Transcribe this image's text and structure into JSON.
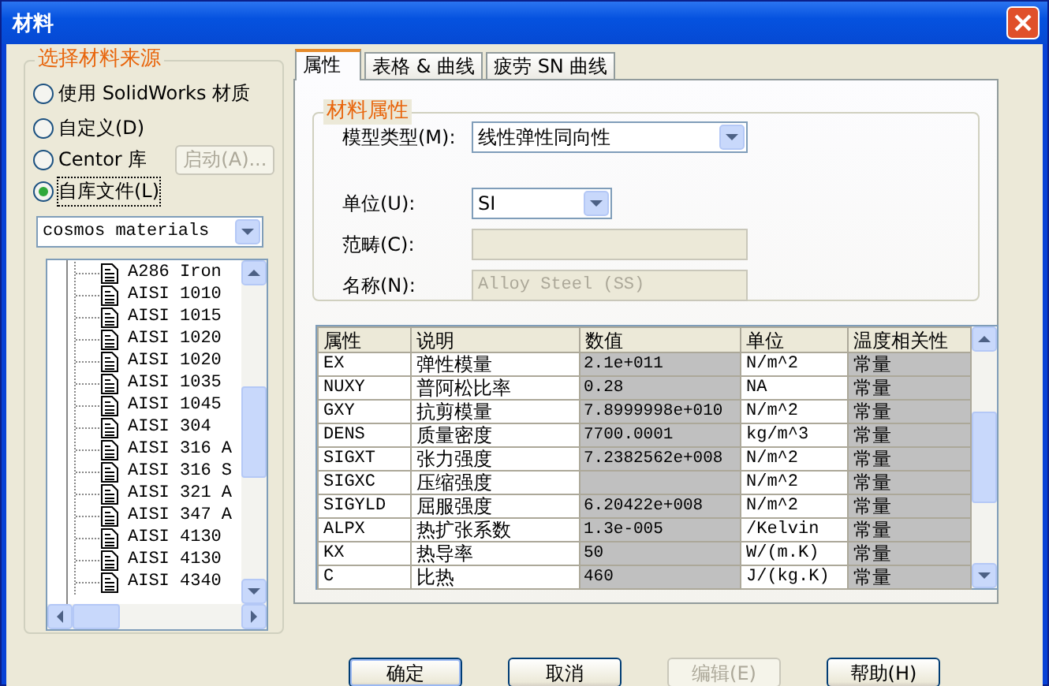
{
  "window": {
    "title": "材料"
  },
  "source_group": {
    "title": "选择材料来源",
    "options": [
      {
        "label": "使用 SolidWorks 材质",
        "selected": false
      },
      {
        "label": "自定义(D)",
        "selected": false
      },
      {
        "label": "Centor 库",
        "selected": false,
        "button": {
          "label": "启动(A)...",
          "disabled": true
        }
      },
      {
        "label": "自库文件(L)",
        "selected": true
      }
    ],
    "library": {
      "value": "cosmos materials"
    },
    "tree": {
      "items": [
        "A286 Iron",
        "AISI 1010",
        "AISI 1015",
        "AISI 1020",
        "AISI 1020",
        "AISI 1035",
        "AISI 1045",
        "AISI 304",
        "AISI 316 A",
        "AISI 316 S",
        "AISI 321 A",
        "AISI 347 A",
        "AISI 4130",
        "AISI 4130",
        "AISI 4340"
      ]
    }
  },
  "tabs": [
    {
      "label": "属性",
      "selected": true
    },
    {
      "label": "表格 & 曲线",
      "selected": false
    },
    {
      "label": "疲劳 SN 曲线",
      "selected": false
    }
  ],
  "properties_group": {
    "title": "材料属性",
    "fields": [
      {
        "label": "模型类型(M):",
        "kind": "combo",
        "value": "线性弹性同向性",
        "disabled": false
      },
      {
        "label": "单位(U):",
        "kind": "combo",
        "value": "SI",
        "disabled": false
      },
      {
        "label": "范畴(C):",
        "kind": "text",
        "disabled": true
      },
      {
        "label": "名称(N):",
        "kind": "text",
        "value": "Alloy Steel (SS)",
        "disabled": true
      }
    ]
  },
  "table": {
    "columns": [
      {
        "label": "属性",
        "shaded": false
      },
      {
        "label": "说明",
        "shaded": false
      },
      {
        "label": "数值",
        "shaded": true
      },
      {
        "label": "单位",
        "shaded": false
      },
      {
        "label": "温度相关性",
        "shaded": true
      }
    ],
    "rows": [
      [
        "EX",
        "弹性模量",
        "2.1e+011",
        "N/m^2",
        "常量"
      ],
      [
        "NUXY",
        "普阿松比率",
        "0.28",
        "NA",
        "常量"
      ],
      [
        "GXY",
        "抗剪模量",
        "7.8999998e+010",
        "N/m^2",
        "常量"
      ],
      [
        "DENS",
        "质量密度",
        "7700.0001",
        "kg/m^3",
        "常量"
      ],
      [
        "SIGXT",
        "张力强度",
        "7.2382562e+008",
        "N/m^2",
        "常量"
      ],
      [
        "SIGXC",
        "压缩强度",
        "",
        "N/m^2",
        "常量"
      ],
      [
        "SIGYLD",
        "屈服强度",
        "6.20422e+008",
        "N/m^2",
        "常量"
      ],
      [
        "ALPX",
        "热扩张系数",
        "1.3e-005",
        "/Kelvin",
        "常量"
      ],
      [
        "KX",
        "热导率",
        "50",
        "W/(m.K)",
        "常量"
      ],
      [
        "C",
        "比热",
        "460",
        "J/(kg.K)",
        "常量"
      ]
    ]
  },
  "buttons": [
    {
      "label": "确定",
      "disabled": false,
      "default": true
    },
    {
      "label": "取消",
      "disabled": false,
      "default": false
    },
    {
      "label": "编辑(E)",
      "disabled": true,
      "default": false
    },
    {
      "label": "帮助(H)",
      "disabled": false,
      "default": false
    }
  ]
}
